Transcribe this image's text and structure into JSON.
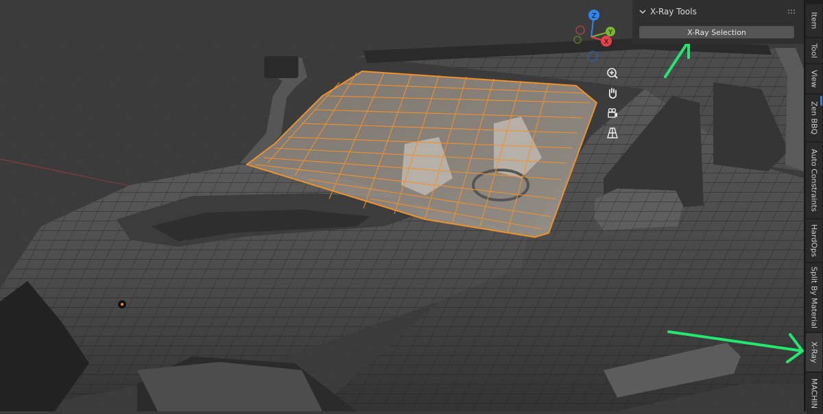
{
  "panel": {
    "title": "X-Ray Tools",
    "button_label": "X-Ray Selection"
  },
  "tabs": [
    {
      "label": "Item"
    },
    {
      "label": "Tool"
    },
    {
      "label": "View"
    },
    {
      "label": "Zen BBQ"
    },
    {
      "label": "Auto Constraints"
    },
    {
      "label": "HardOps"
    },
    {
      "label": "Split By Material"
    },
    {
      "label": "X-Ray"
    },
    {
      "label": "MACHIN"
    }
  ],
  "gizmo": {
    "z": "Z",
    "y": "Y",
    "x": "X"
  },
  "nav_icons": [
    "zoom-icon",
    "hand-pan-icon",
    "camera-icon",
    "grid-perspective-icon"
  ],
  "colors": {
    "selection": "#f0922a",
    "annotation_arrow": "#22e870",
    "axis_x": "#e8404a",
    "axis_y": "#7ab82e",
    "axis_z": "#2f86ec"
  }
}
